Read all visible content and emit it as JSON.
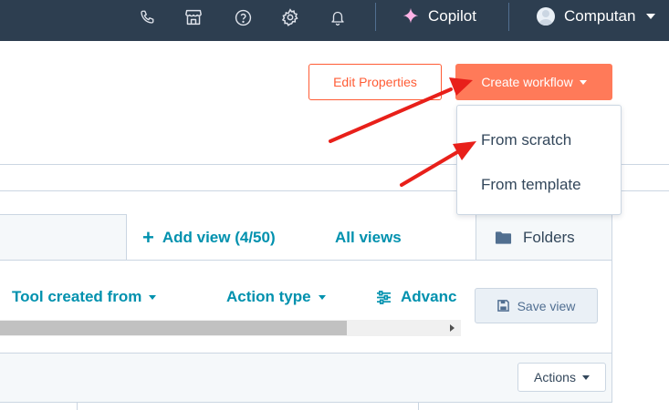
{
  "topnav": {
    "icons": [
      "phone-icon",
      "marketplace-icon",
      "help-icon",
      "settings-icon",
      "notifications-icon"
    ],
    "copilot_label": "Copilot",
    "account_name": "Computan"
  },
  "header": {
    "edit_properties_label": "Edit Properties",
    "create_workflow_label": "Create workflow"
  },
  "create_menu": {
    "items": [
      {
        "label": "From scratch"
      },
      {
        "label": "From template"
      }
    ]
  },
  "views": {
    "add_view_label": "Add view (4/50)",
    "all_views_label": "All views",
    "folders_label": "Folders"
  },
  "filters": {
    "items": [
      {
        "label": "Tool created from"
      },
      {
        "label": "Action type"
      },
      {
        "label": "Advanc"
      }
    ],
    "save_view_label": "Save view"
  },
  "table": {
    "actions_label": "Actions"
  },
  "colors": {
    "nav_bg": "#2d3e50",
    "accent": "#ff7a59",
    "link": "#0091ae",
    "annotation_arrow": "#e8201a"
  }
}
